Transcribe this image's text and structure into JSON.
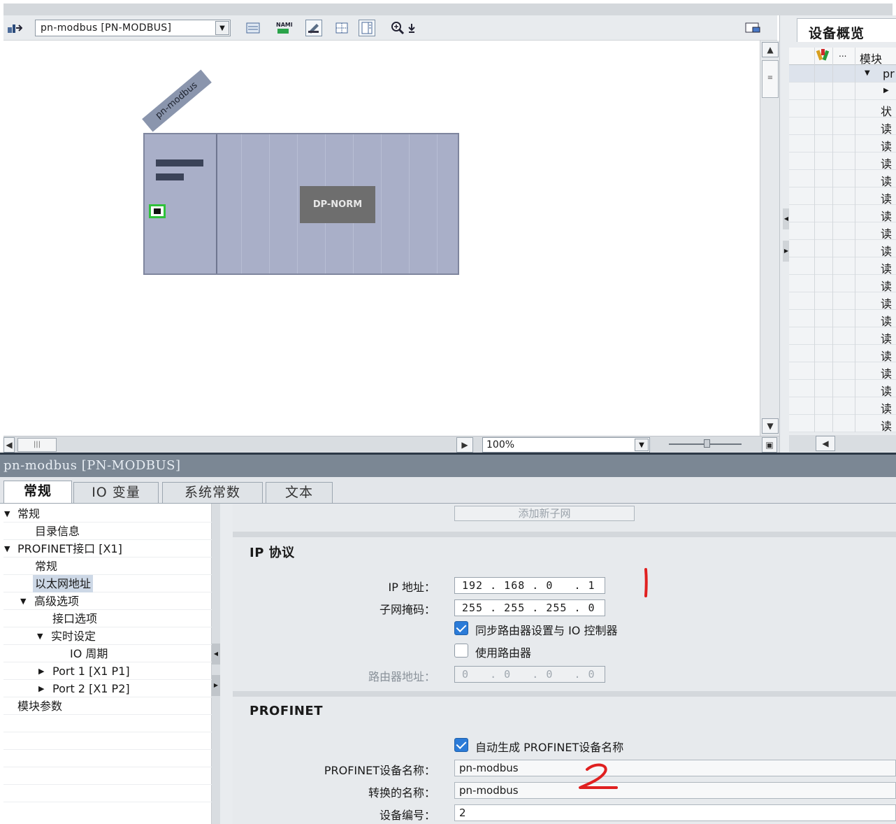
{
  "toolbar": {
    "device_select": "pn-modbus [PN-MODBUS]",
    "icons": [
      "network-view-icon",
      "device-list-icon",
      "name-icon",
      "plug-icon",
      "grid-icon",
      "panel-icon",
      "zoom-in-icon",
      "settings-icon"
    ]
  },
  "canvas": {
    "station_tag": "pn-modbus",
    "module_label": "DP-NORM"
  },
  "zoom": {
    "value": "100%"
  },
  "overview": {
    "title": "设备概览",
    "col_ellipsis": "...",
    "col_module": "模块",
    "rows": [
      "pr",
      "",
      "状",
      "读",
      "读",
      "读",
      "读",
      "读",
      "读",
      "读",
      "读",
      "读",
      "读",
      "读",
      "读",
      "读",
      "读",
      "读",
      "读",
      "读",
      "读"
    ]
  },
  "inspector": {
    "title": "pn-modbus [PN-MODBUS]",
    "tabs": [
      "常规",
      "IO 变量",
      "系统常数",
      "文本"
    ]
  },
  "nav": {
    "items": [
      "常规",
      "目录信息",
      "PROFINET接口 [X1]",
      "常规",
      "以太网地址",
      "高级选项",
      "接口选项",
      "实时设定",
      "IO 周期",
      "Port 1 [X1 P1]",
      "Port 2 [X1 P2]",
      "模块参数"
    ]
  },
  "props": {
    "add_subnet": "添加新子网",
    "ip_section": "IP 协议",
    "ip_label": "IP 地址：",
    "ip_value": "192 . 168 . 0   . 1",
    "mask_label": "子网掩码：",
    "mask_value": "255 . 255 . 255 . 0",
    "sync_router": "同步路由器设置与 IO 控制器",
    "use_router": "使用路由器",
    "router_label": "路由器地址：",
    "router_value": "0   . 0   . 0   . 0",
    "pn_section": "PROFINET",
    "auto_name": "自动生成 PROFINET设备名称",
    "pn_name_label": "PROFINET设备名称：",
    "pn_name_value": "pn-modbus",
    "converted_label": "转换的名称：",
    "converted_value": "pn-modbus",
    "device_no_label": "设备编号：",
    "device_no_value": "2"
  },
  "annotations": {
    "mark1": "1",
    "mark2": "2",
    "color": "#e02020"
  }
}
